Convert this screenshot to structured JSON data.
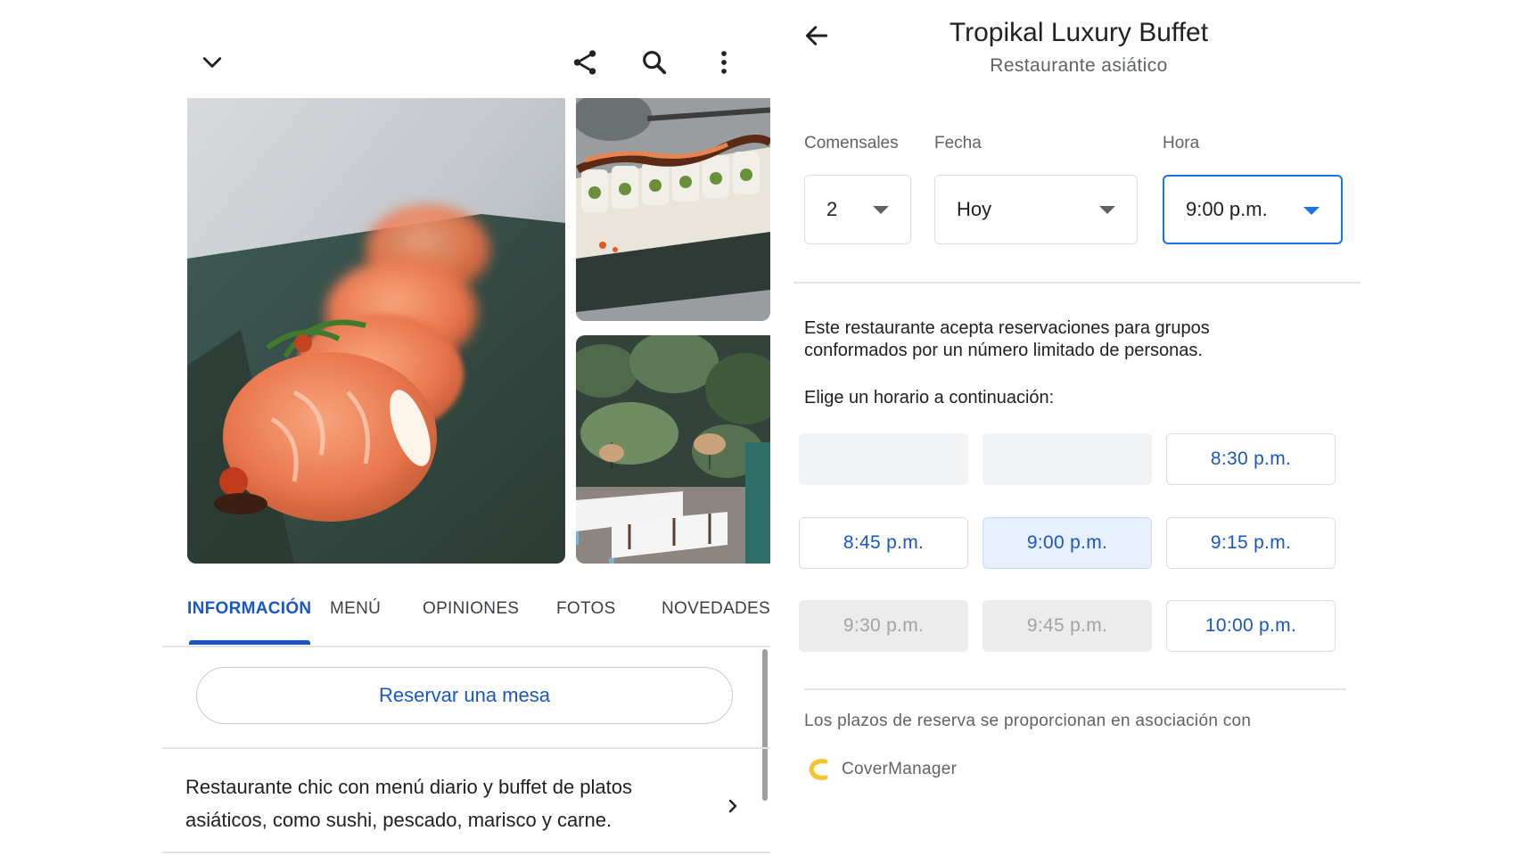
{
  "left": {
    "tabs": [
      {
        "label": "INFORMACIÓN",
        "active": true
      },
      {
        "label": "MENÚ",
        "active": false
      },
      {
        "label": "OPINIONES",
        "active": false
      },
      {
        "label": "FOTOS",
        "active": false
      },
      {
        "label": "NOVEDADES",
        "active": false
      }
    ],
    "reserve_button": "Reservar una mesa",
    "description": "Restaurante chic con menú diario y buffet de platos asiáticos, como sushi, pescado, marisco y carne.",
    "icons": {
      "collapse": "chevron-down-icon",
      "share": "share-icon",
      "search": "search-icon",
      "more": "more-vert-icon",
      "details": "chevron-right-icon"
    }
  },
  "right": {
    "title": "Tropikal Luxury Buffet",
    "subtitle": "Restaurante asiático",
    "fields": {
      "guests": {
        "label": "Comensales",
        "value": "2"
      },
      "date": {
        "label": "Fecha",
        "value": "Hoy"
      },
      "time": {
        "label": "Hora",
        "value": "9:00 p.m."
      }
    },
    "info_text": "Este restaurante acepta reservaciones para grupos conformados por un número limitado de personas.",
    "choose_text": "Elige un horario a continuación:",
    "slots": [
      {
        "label": "",
        "state": "empty"
      },
      {
        "label": "",
        "state": "empty"
      },
      {
        "label": "8:30 p.m.",
        "state": "available"
      },
      {
        "label": "8:45 p.m.",
        "state": "available"
      },
      {
        "label": "9:00 p.m.",
        "state": "selected"
      },
      {
        "label": "9:15 p.m.",
        "state": "available"
      },
      {
        "label": "9:30 p.m.",
        "state": "disabled"
      },
      {
        "label": "9:45 p.m.",
        "state": "disabled"
      },
      {
        "label": "10:00 p.m.",
        "state": "available"
      }
    ],
    "partner_text": "Los plazos de reserva se proporcionan en asociación con",
    "partner_name": "CoverManager",
    "back_icon": "arrow-back-icon"
  },
  "colors": {
    "accent": "#1a56c8",
    "focus": "#1a73e8",
    "selected_bg": "#e8f0fe",
    "partner_logo": "#f4c430"
  }
}
